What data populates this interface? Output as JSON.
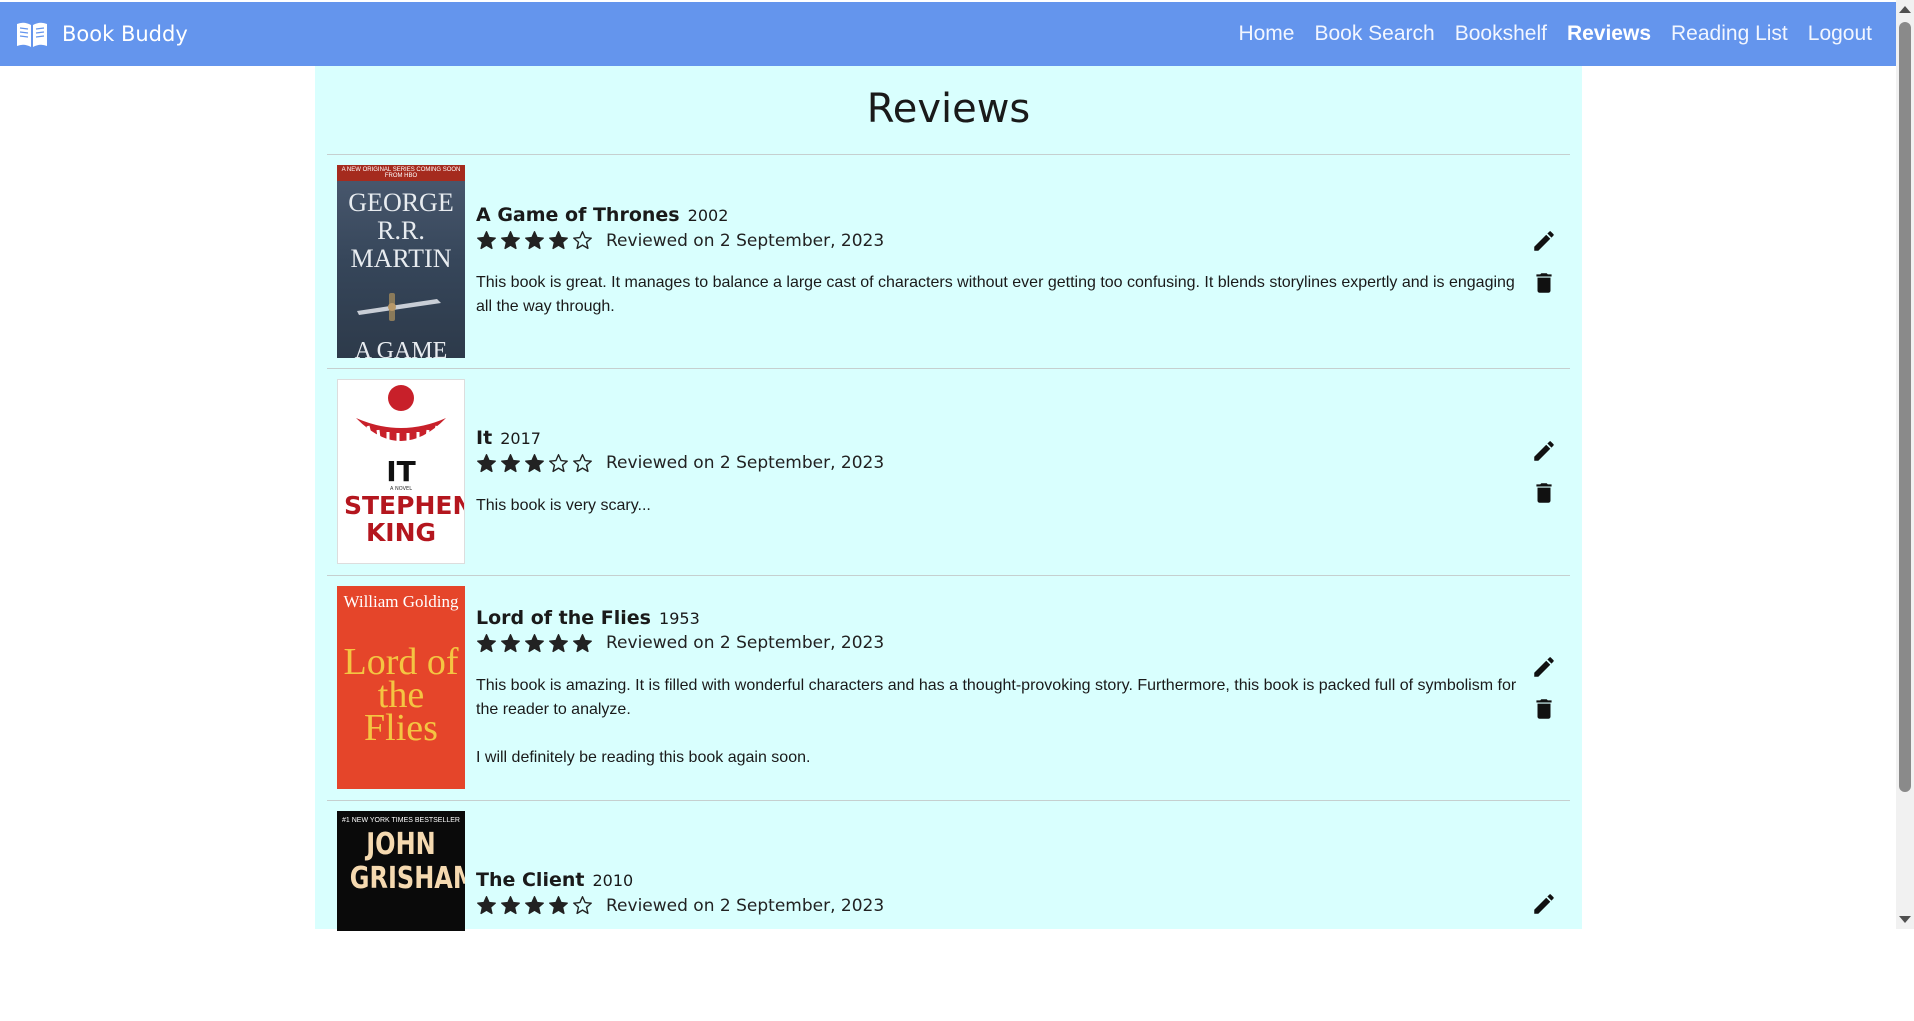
{
  "nav": {
    "brand": "Book Buddy",
    "links": [
      "Home",
      "Book Search",
      "Bookshelf",
      "Reviews",
      "Reading List",
      "Logout"
    ],
    "active": "Reviews"
  },
  "page": {
    "title": "Reviews"
  },
  "reviews": [
    {
      "title": "A Game of Thrones",
      "year": "2002",
      "rating": 4,
      "reviewed": "Reviewed on 2 September, 2023",
      "text": "This book is great. It manages to balance a large cast of characters without ever getting too confusing. It blends storylines expertly and is engaging all the way through.",
      "cover": {
        "top": "A NEW ORIGINAL SERIES COMING SOON FROM HBO",
        "author": "GEORGE R.R. MARTIN",
        "title": "A GAME OF THRONES"
      }
    },
    {
      "title": "It",
      "year": "2017",
      "rating": 3,
      "reviewed": "Reviewed on 2 September, 2023",
      "text": "This book is very scary...",
      "cover": {
        "title": "IT",
        "sub": "A NOVEL",
        "author": "STEPHEN KING"
      }
    },
    {
      "title": "Lord of the Flies",
      "year": "1953",
      "rating": 5,
      "reviewed": "Reviewed on 2 September, 2023",
      "text": "This book is amazing. It is filled with wonderful characters and has a thought-provoking story. Furthermore, this book is packed full of symbolism for the reader to analyze.\n\nI will definitely be reading this book again soon.",
      "cover": {
        "author": "William Golding",
        "title": "Lord of the Flies"
      }
    },
    {
      "title": "The Client",
      "year": "2010",
      "rating": 4,
      "reviewed": "Reviewed on 2 September, 2023",
      "text": "",
      "cover": {
        "top": "#1 NEW YORK TIMES BESTSELLER",
        "author": "JOHN GRISHAM"
      }
    }
  ],
  "colors": {
    "navbar": "#6495ed",
    "panel": "#d9fffe"
  },
  "icons": {
    "edit": "pencil-icon",
    "delete": "trash-icon",
    "brand": "open-book-icon"
  }
}
